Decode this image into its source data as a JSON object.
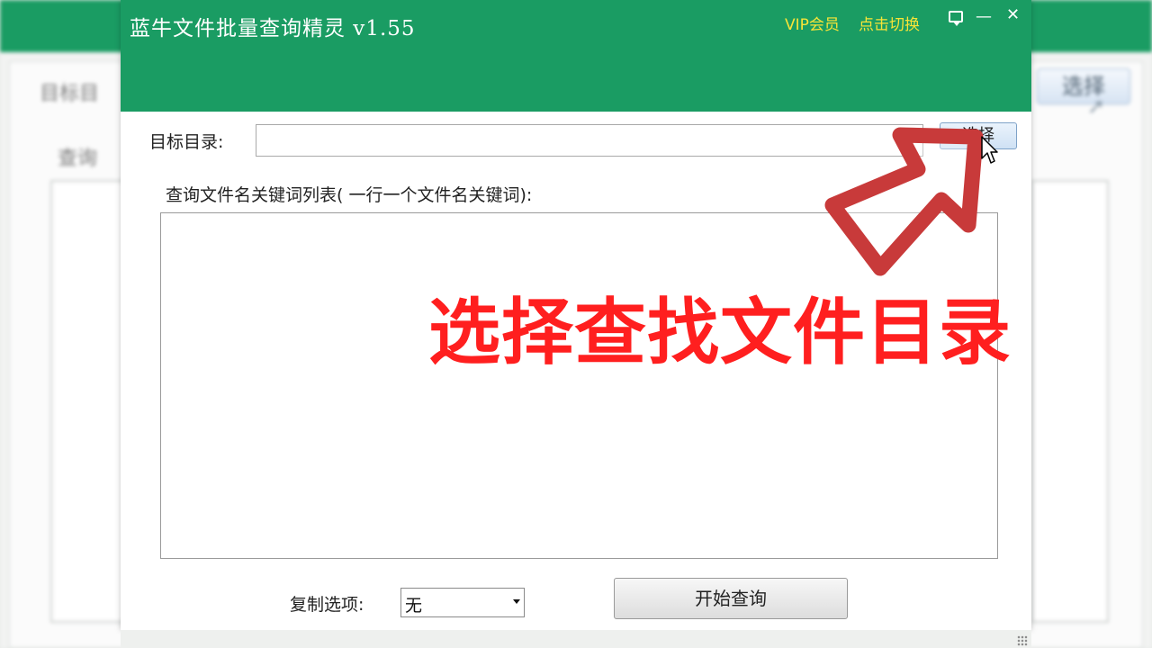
{
  "background": {
    "label_target": "目标目",
    "label_query": "查询",
    "select_button": "选择"
  },
  "window": {
    "title": "蓝牛文件批量查询精灵 v1.55",
    "vip_label": "VIP会员",
    "switch_label": "点击切换",
    "minimize_glyph": "—",
    "close_glyph": "✕"
  },
  "form": {
    "target_label": "目标目录:",
    "target_value": "",
    "select_button": "选择",
    "list_label": "查询文件名关键词列表( 一行一个文件名关键词):",
    "list_value": "",
    "copy_label": "复制选项:",
    "copy_selected": "无",
    "start_button": "开始查询"
  },
  "overlay": {
    "caption": "选择查找文件目录",
    "caption_color": "#ff1f1f",
    "arrow_color": "#c83a3a"
  },
  "colors": {
    "header": "#1a9c63",
    "accent_text": "#f7e437"
  }
}
